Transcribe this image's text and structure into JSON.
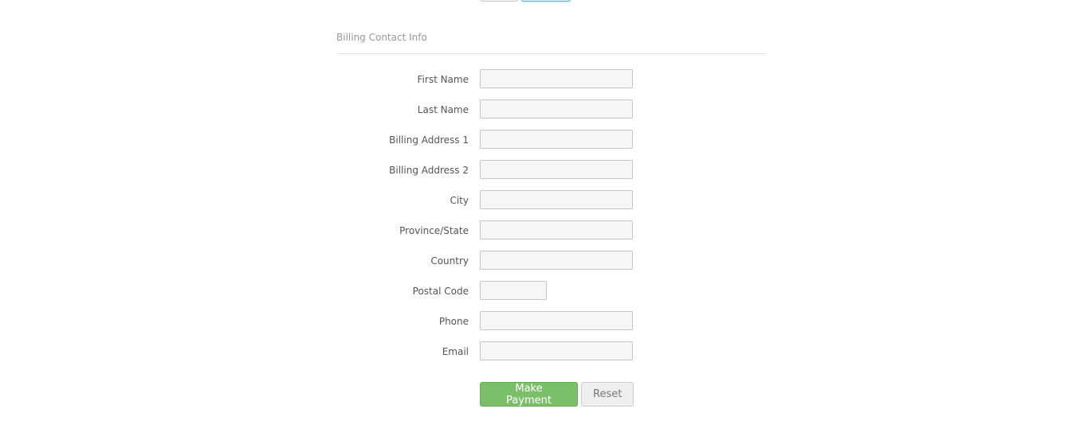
{
  "section": {
    "legend": "Billing Contact Info"
  },
  "fields": [
    {
      "label": "First Name",
      "value": ""
    },
    {
      "label": "Last Name",
      "value": ""
    },
    {
      "label": "Billing Address 1",
      "value": ""
    },
    {
      "label": "Billing Address 2",
      "value": ""
    },
    {
      "label": "City",
      "value": ""
    },
    {
      "label": "Province/State",
      "value": ""
    },
    {
      "label": "Country",
      "value": ""
    },
    {
      "label": "Postal Code",
      "value": ""
    },
    {
      "label": "Phone",
      "value": ""
    },
    {
      "label": "Email",
      "value": ""
    }
  ],
  "actions": {
    "submit_label": "Make Payment",
    "reset_label": "Reset"
  },
  "colors": {
    "primary_button": "#7bbf6a",
    "focus_border": "#66afe9"
  }
}
